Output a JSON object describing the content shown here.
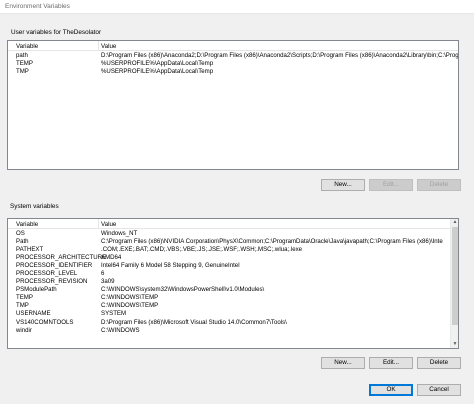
{
  "window": {
    "title": "Environment Variables"
  },
  "user_section": {
    "label": "User variables for TheDesolator",
    "headers": [
      "Variable",
      "Value"
    ],
    "rows": [
      [
        "path",
        "D:\\Program Files (x86)\\Anaconda2;D:\\Program Files (x86)\\Anaconda2\\Scripts;D:\\Program Files (x86)\\Anaconda2\\Library\\bin;C:\\Progr"
      ],
      [
        "TEMP",
        "%USERPROFILE%\\AppData\\Local\\Temp"
      ],
      [
        "TMP",
        "%USERPROFILE%\\AppData\\Local\\Temp"
      ]
    ],
    "buttons": {
      "new": "New...",
      "edit": "Edit...",
      "delete": "Delete"
    }
  },
  "system_section": {
    "label": "System variables",
    "headers": [
      "Variable",
      "Value"
    ],
    "rows": [
      [
        "OS",
        "Windows_NT"
      ],
      [
        "Path",
        "C:\\Program Files (x86)\\NVIDIA Corporation\\PhysX\\Common;C:\\ProgramData\\Oracle\\Java\\javapath;C:\\Program Files (x86)\\Inte"
      ],
      [
        "PATHEXT",
        ".COM;.EXE;.BAT;.CMD;.VBS;.VBE;.JS;.JSE;.WSF;.WSH;.MSC;.wlua;.lexe"
      ],
      [
        "PROCESSOR_ARCHITECTURE",
        "AMD64"
      ],
      [
        "PROCESSOR_IDENTIFIER",
        "Intel64 Family 6 Model 58 Stepping 9, GenuineIntel"
      ],
      [
        "PROCESSOR_LEVEL",
        "6"
      ],
      [
        "PROCESSOR_REVISION",
        "3a09"
      ],
      [
        "PSModulePath",
        "C:\\WINDOWS\\system32\\WindowsPowerShell\\v1.0\\Modules\\"
      ],
      [
        "TEMP",
        "C:\\WINDOWS\\TEMP"
      ],
      [
        "TMP",
        "C:\\WINDOWS\\TEMP"
      ],
      [
        "USERNAME",
        "SYSTEM"
      ],
      [
        "VS140COMNTOOLS",
        "D:\\Program Files (x86)\\Microsoft Visual Studio 14.0\\Common7\\Tools\\"
      ],
      [
        "windir",
        "C:\\WINDOWS"
      ]
    ],
    "buttons": {
      "new": "New...",
      "edit": "Edit...",
      "delete": "Delete"
    }
  },
  "footer": {
    "ok": "OK",
    "cancel": "Cancel"
  }
}
